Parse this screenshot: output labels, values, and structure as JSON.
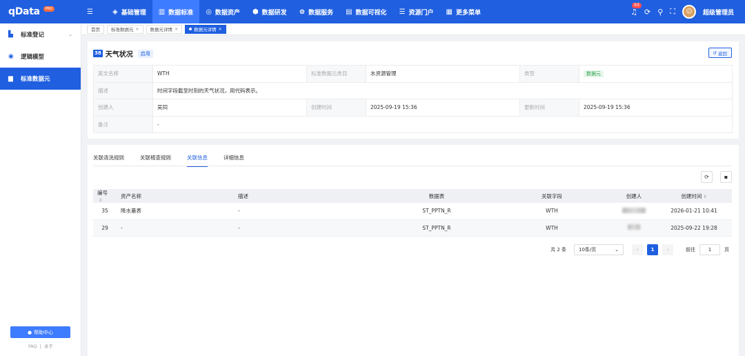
{
  "brand": {
    "name": "qData",
    "badge": "PRO"
  },
  "header": {
    "nav": [
      {
        "label": "基础管理",
        "icon": "cube-icon",
        "glyph": "◈"
      },
      {
        "label": "数据标准",
        "icon": "book-icon",
        "glyph": "▥"
      },
      {
        "label": "数据资产",
        "icon": "target-icon",
        "glyph": "◎"
      },
      {
        "label": "数据研发",
        "icon": "box-icon",
        "glyph": "⬢"
      },
      {
        "label": "数据服务",
        "icon": "nodes-icon",
        "glyph": "⊚"
      },
      {
        "label": "数据可视化",
        "icon": "chart-icon",
        "glyph": "▤"
      },
      {
        "label": "资源门户",
        "icon": "portal-icon",
        "glyph": "☰"
      },
      {
        "label": "更多菜单",
        "icon": "grid-icon",
        "glyph": "▦"
      }
    ],
    "notify_count": "93",
    "user_name": "超级管理员"
  },
  "sidebar": {
    "items": [
      {
        "label": "标准登记"
      },
      {
        "label": "逻辑模型"
      },
      {
        "label": "标准数据元"
      }
    ],
    "help": "帮助中心",
    "faq": "FAQ",
    "about": "关于"
  },
  "tabs": [
    {
      "label": "首页"
    },
    {
      "label": "标准数据元"
    },
    {
      "label": "数据元详情"
    },
    {
      "label": "数据元详情"
    }
  ],
  "detail": {
    "id": "38",
    "title": "天气状况",
    "status": "启用",
    "back": "返回",
    "rows": {
      "en_name_label": "英文名称",
      "en_name": "WTH",
      "category_label": "标准数据元类目",
      "category": "水资源管理",
      "type_label": "类型",
      "type": "数据元",
      "desc_label": "描述",
      "desc": "时间字段截至时刻的天气状况，用代码表示。",
      "creator_label": "创建人",
      "creator": "吴同",
      "created_label": "创建时间",
      "created": "2025-09-19 15:36",
      "updated_label": "更新时间",
      "updated": "2025-09-19 15:36",
      "remark_label": "备注",
      "remark": "-"
    }
  },
  "subtabs": [
    {
      "label": "关联清洗规则"
    },
    {
      "label": "关联稽查规则"
    },
    {
      "label": "关联信息"
    },
    {
      "label": "详细信息"
    }
  ],
  "table": {
    "headers": [
      "编号",
      "资产名称",
      "描述",
      "数据表",
      "关联字段",
      "创建人",
      "创建时间"
    ],
    "rows": [
      {
        "id": "35",
        "name": "降水量表",
        "desc": "-",
        "tbl": "ST_PPTN_R",
        "field": "WTH",
        "time": "2026-01-21 10:41"
      },
      {
        "id": "29",
        "name": "-",
        "desc": "-",
        "tbl": "ST_PPTN_R",
        "field": "WTH",
        "time": "2025-09-22 19:28"
      }
    ]
  },
  "pagination": {
    "total": "共 2 条",
    "page_size": "10条/页",
    "current": "1",
    "goto_prefix": "前往",
    "goto_value": "1",
    "goto_suffix": "页"
  }
}
